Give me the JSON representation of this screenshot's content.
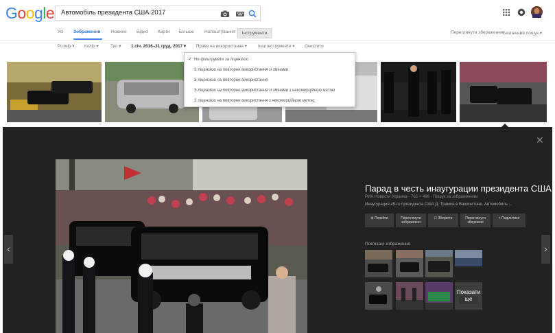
{
  "header": {
    "logo": "Google",
    "logo_colors": [
      "#4285f4",
      "#ea4335",
      "#fbbc05",
      "#4285f4",
      "#34a853",
      "#ea4335"
    ],
    "search_query": "Автомобіль президента США 2017",
    "icons": [
      "camera-icon",
      "keyboard-icon",
      "search-icon",
      "apps-grid-icon",
      "notifications-icon",
      "avatar"
    ]
  },
  "tabs": {
    "items": [
      "Усі",
      "Зображення",
      "Новини",
      "Відео",
      "Карти",
      "Більше",
      "Налаштування",
      "Інструменти"
    ],
    "active": "Зображення",
    "right_links": [
      "Переглянути збереження",
      "Безпечний пошук ▾"
    ]
  },
  "filters": {
    "items": [
      "Розмір ▾",
      "Колір ▾",
      "Тип ▾",
      "1 січ. 2016–31 груд. 2017 ▾",
      "Права на використання ▾",
      "Інші інструменти ▾",
      "Очистити"
    ]
  },
  "dropdown": {
    "items": [
      {
        "label": "Не фільтрувати за ліцензією",
        "checked": true
      },
      {
        "label": "З ліцензією на повторне використання зі змінами",
        "checked": false
      },
      {
        "label": "З ліцензією на повторне використання",
        "checked": false
      },
      {
        "label": "З ліцензією на повторне використання зі змінами з некомерційною метою",
        "checked": false
      },
      {
        "label": "З ліцензією на повторне використання з некомерційною метою",
        "checked": false
      }
    ]
  },
  "panel": {
    "title": "Парад в честь инаугурации президента США ...",
    "source": "РИА Новости Украина - 765 × 496 - Пошук за зображенням",
    "description": "Инаугурация 45-го президента США Д. Трампа в Вашингтоне. Автомобиль ...",
    "buttons": [
      {
        "label": "Перейти",
        "icon": "globe-icon"
      },
      {
        "label": "Переглянути зображення",
        "icon": ""
      },
      {
        "label": "Зберегти",
        "icon": "bookmark-icon"
      },
      {
        "label": "Переглянути збережені",
        "icon": ""
      },
      {
        "label": "Поділитися",
        "icon": "share-icon"
      }
    ],
    "related_heading": "Пов'язані зображення",
    "more_label": "Показати ще",
    "close_icon": "close-icon",
    "prev_icon": "chevron-left-icon",
    "next_icon": "chevron-right-icon"
  },
  "colors": {
    "accent": "#4285f4",
    "panel_bg": "#222222",
    "page_bg": "#ffffff"
  }
}
